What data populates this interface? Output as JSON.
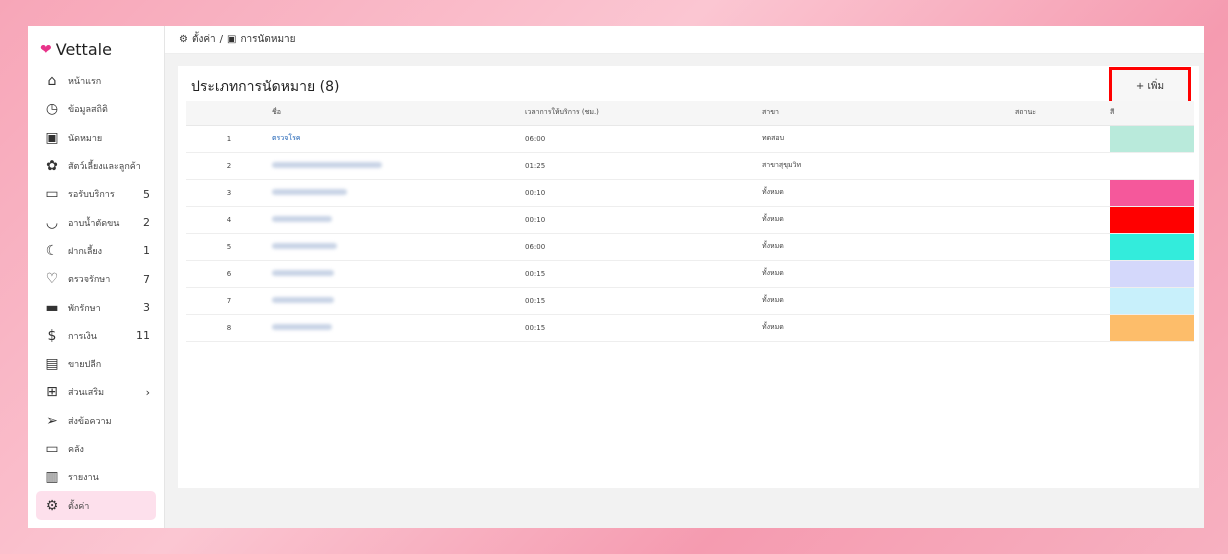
{
  "app": {
    "logo": "Vettale"
  },
  "breadcrumb": {
    "root": "ตั้งค่า",
    "sep": "/",
    "current": "การนัดหมาย"
  },
  "sidebar": {
    "items": [
      {
        "icon": "home-icon",
        "glyph": "⌂",
        "label": "หน้าแรก",
        "count": ""
      },
      {
        "icon": "stats-icon",
        "glyph": "◷",
        "label": "ข้อมูลสถิติ",
        "count": ""
      },
      {
        "icon": "calendar-icon",
        "glyph": "▣",
        "label": "นัดหมาย",
        "count": ""
      },
      {
        "icon": "paw-icon",
        "glyph": "✿",
        "label": "สัตว์เลี้ยงและลูกค้า",
        "count": ""
      },
      {
        "icon": "sofa-icon",
        "glyph": "▭",
        "label": "รอรับบริการ",
        "count": "5"
      },
      {
        "icon": "bath-icon",
        "glyph": "◡",
        "label": "อาบน้ำตัดขน",
        "count": "2"
      },
      {
        "icon": "moon-icon",
        "glyph": "☾",
        "label": "ฝากเลี้ยง",
        "count": "1"
      },
      {
        "icon": "stethoscope-icon",
        "glyph": "♡",
        "label": "ตรวจรักษา",
        "count": "7"
      },
      {
        "icon": "bed-icon",
        "glyph": "▬",
        "label": "พักรักษา",
        "count": "3"
      },
      {
        "icon": "money-icon",
        "glyph": "$",
        "label": "การเงิน",
        "count": "11"
      },
      {
        "icon": "register-icon",
        "glyph": "▤",
        "label": "ขายปลีก",
        "count": ""
      },
      {
        "icon": "plus-box-icon",
        "glyph": "⊞",
        "label": "ส่วนเสริม",
        "count": "›"
      },
      {
        "icon": "send-icon",
        "glyph": "➢",
        "label": "ส่งข้อความ",
        "count": ""
      },
      {
        "icon": "archive-icon",
        "glyph": "▭",
        "label": "คลัง",
        "count": ""
      },
      {
        "icon": "chart-icon",
        "glyph": "▥",
        "label": "รายงาน",
        "count": ""
      },
      {
        "icon": "gear-icon",
        "glyph": "⚙",
        "label": "ตั้งค่า",
        "count": ""
      }
    ]
  },
  "page": {
    "title": "ประเภทการนัดหมาย (8)",
    "add_label": "+ เพิ่ม"
  },
  "table": {
    "headers": [
      "",
      "ชื่อ",
      "เวลาการให้บริการ (ชม.)",
      "สาขา",
      "สถานะ",
      "สี"
    ],
    "rows": [
      {
        "no": "1",
        "name": "ตรวจโรค",
        "time": "06:00",
        "branch": "ทดสอบ",
        "color": "#b9eadb"
      },
      {
        "no": "2",
        "name": "",
        "time": "01:25",
        "branch": "สาขาสุขุมวิท",
        "color": ""
      },
      {
        "no": "3",
        "name": "",
        "time": "00:10",
        "branch": "ทั้งหมด",
        "color": "#f5589b"
      },
      {
        "no": "4",
        "name": "",
        "time": "00:10",
        "branch": "ทั้งหมด",
        "color": "#ff0000"
      },
      {
        "no": "5",
        "name": "",
        "time": "06:00",
        "branch": "ทั้งหมด",
        "color": "#33ecdc"
      },
      {
        "no": "6",
        "name": "",
        "time": "00:15",
        "branch": "ทั้งหมด",
        "color": "#d4d8fb"
      },
      {
        "no": "7",
        "name": "",
        "time": "00:15",
        "branch": "ทั้งหมด",
        "color": "#c8f0fb"
      },
      {
        "no": "8",
        "name": "",
        "time": "00:15",
        "branch": "ทั้งหมด",
        "color": "#fdbd6a"
      }
    ]
  }
}
